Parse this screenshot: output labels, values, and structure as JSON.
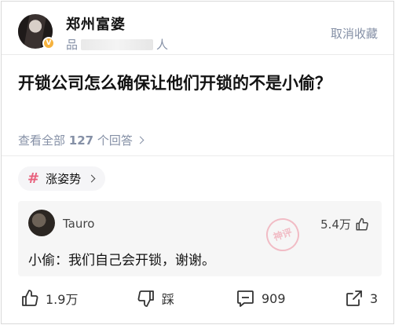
{
  "author": {
    "name": "郑州富婆",
    "bio_prefix": "品",
    "bio_suffix": "人",
    "badge_icon": "verified-badge-icon",
    "badge_color": "#f6b23d"
  },
  "header": {
    "unfollow_label": "取消收藏"
  },
  "question": {
    "title": "开锁公司怎么确保让他们开锁的不是小偷？",
    "answers_prefix": "查看全部 ",
    "answers_count": "127",
    "answers_suffix": " 个回答"
  },
  "topic_tag": {
    "label": "涨姿势",
    "icon": "hash-icon",
    "icon_color": "#e8617d"
  },
  "hot_comment": {
    "user": "Tauro",
    "likes": "5.4万",
    "stamp": "神评",
    "text": "小偷：我们自己会开锁，谢谢。"
  },
  "actions": {
    "like_count": "1.9万",
    "dislike_label": "踩",
    "comment_count": "909",
    "share_count": "3"
  }
}
